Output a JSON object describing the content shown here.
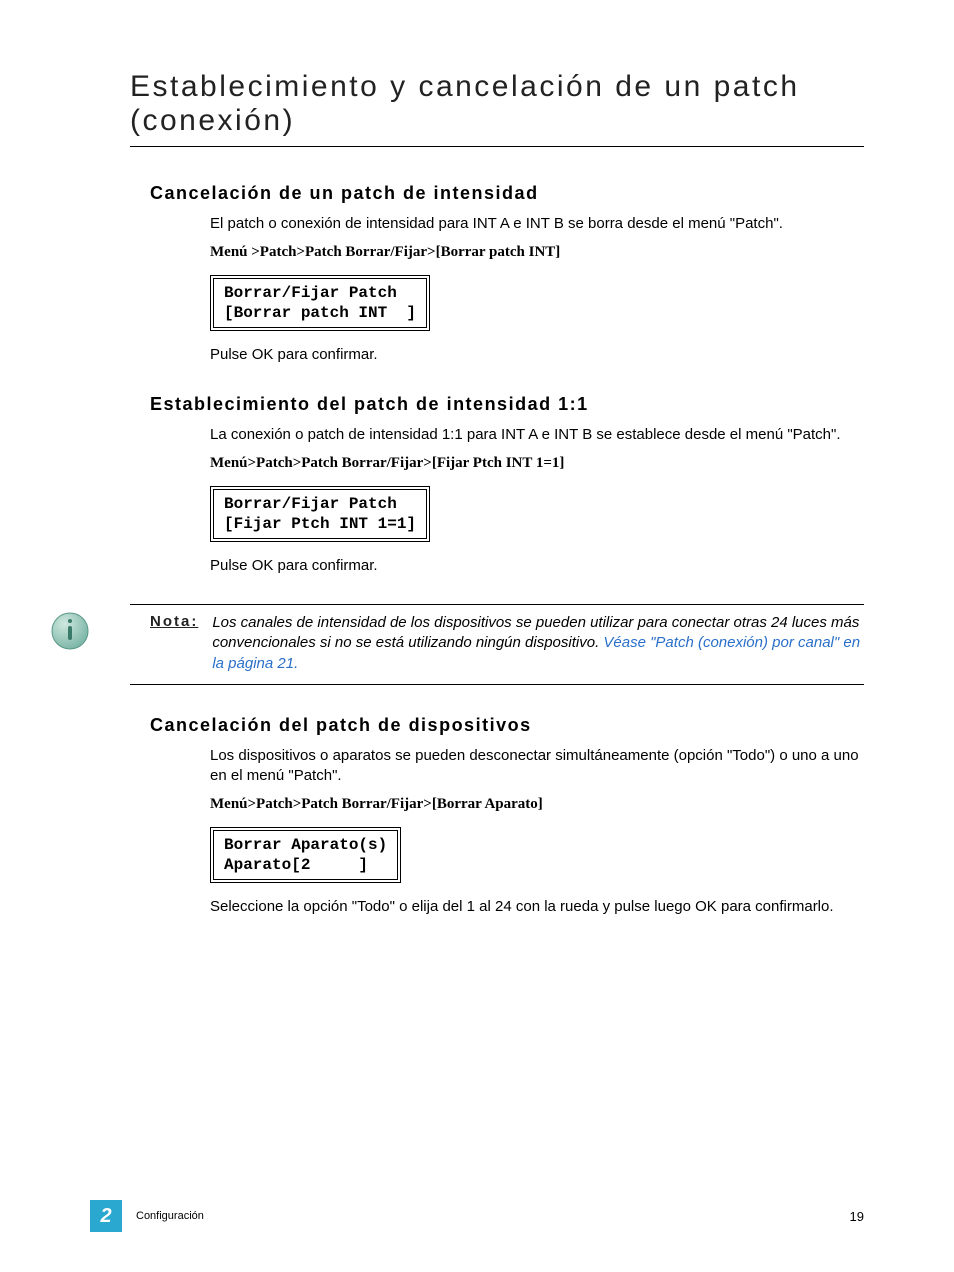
{
  "title": "Establecimiento y cancelación de un patch (conexión)",
  "sections": {
    "s1": {
      "heading": "Cancelación de un patch de intensidad",
      "intro": "El patch o conexión de intensidad para INT A e INT B se borra desde el menú \"Patch\".",
      "menu": "Menú >Patch>Patch Borrar/Fijar>[Borrar patch INT]",
      "lcd": "Borrar/Fijar Patch\n[Borrar patch INT  ]",
      "confirm": "Pulse OK para confirmar."
    },
    "s2": {
      "heading": "Establecimiento del patch de intensidad 1:1",
      "intro": "La conexión o patch de intensidad 1:1 para INT A e INT B se establece desde el menú \"Patch\".",
      "menu": "Menú>Patch>Patch Borrar/Fijar>[Fijar Ptch INT 1=1]",
      "lcd": "Borrar/Fijar Patch\n[Fijar Ptch INT 1=1]",
      "confirm": "Pulse OK para confirmar."
    },
    "s3": {
      "heading": "Cancelación del patch de dispositivos",
      "intro": "Los dispositivos o aparatos se pueden desconectar simultáneamente (opción \"Todo\") o uno a uno en el menú \"Patch\".",
      "menu": "Menú>Patch>Patch Borrar/Fijar>[Borrar Aparato]",
      "lcd": "Borrar Aparato(s)\nAparato[2     ]",
      "confirm": "Seleccione la opción \"Todo\" o elija del 1 al 24 con la rueda y pulse luego OK para confirmarlo."
    }
  },
  "note": {
    "label": "Nota:",
    "text": "Los canales de intensidad de los dispositivos se pueden utilizar para conectar otras 24 luces más convencionales si no se está utilizando ningún dispositivo. ",
    "link": "Véase \"Patch (conexión) por canal\" en la página  21."
  },
  "footer": {
    "chapter": "2",
    "section_label": "Configuración",
    "page": "19"
  }
}
